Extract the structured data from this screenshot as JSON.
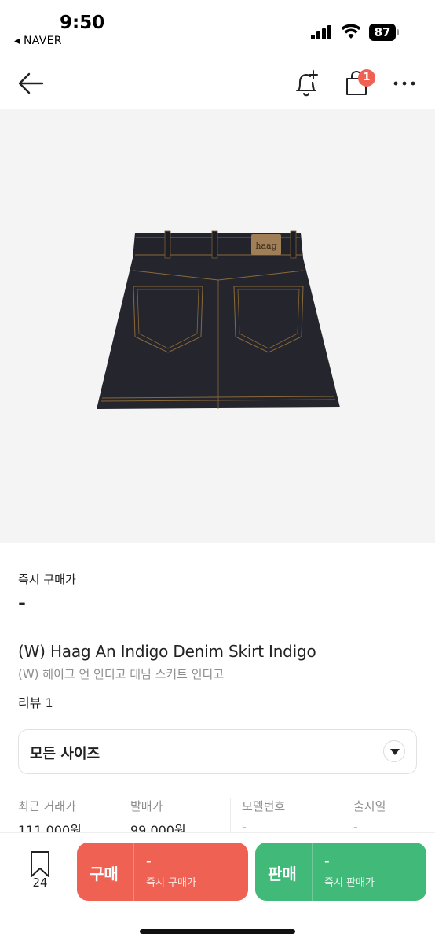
{
  "status_bar": {
    "time": "9:50",
    "back_app": "NAVER",
    "battery": "87"
  },
  "nav": {
    "cart_badge": "1",
    "icons": [
      "back-arrow-icon",
      "bell-plus-icon",
      "shopping-bag-icon",
      "more-icon"
    ]
  },
  "product_image": {
    "brand_label": "haag"
  },
  "price": {
    "instant_label": "즉시 구매가",
    "instant_value": "-"
  },
  "product": {
    "title_en": "(W) Haag An Indigo Denim Skirt Indigo",
    "title_ko": "(W) 헤이그 언 인디고 데님 스커트 인디고",
    "review_link": "리뷰 1"
  },
  "size_select": {
    "value": "모든 사이즈"
  },
  "stats": [
    {
      "label": "최근 거래가",
      "value": "111,000원"
    },
    {
      "label": "발매가",
      "value": "99,000원"
    },
    {
      "label": "모델번호",
      "value": "-"
    },
    {
      "label": "출시일",
      "value": "-"
    }
  ],
  "bottom_bar": {
    "bookmark_count": "24",
    "buy": {
      "label": "구매",
      "price": "-",
      "sub": "즉시 구매가"
    },
    "sell": {
      "label": "판매",
      "price": "-",
      "sub": "즉시 판매가"
    }
  },
  "colors": {
    "buy": "#ef6253",
    "sell": "#41b979",
    "badge": "#ef6253"
  }
}
